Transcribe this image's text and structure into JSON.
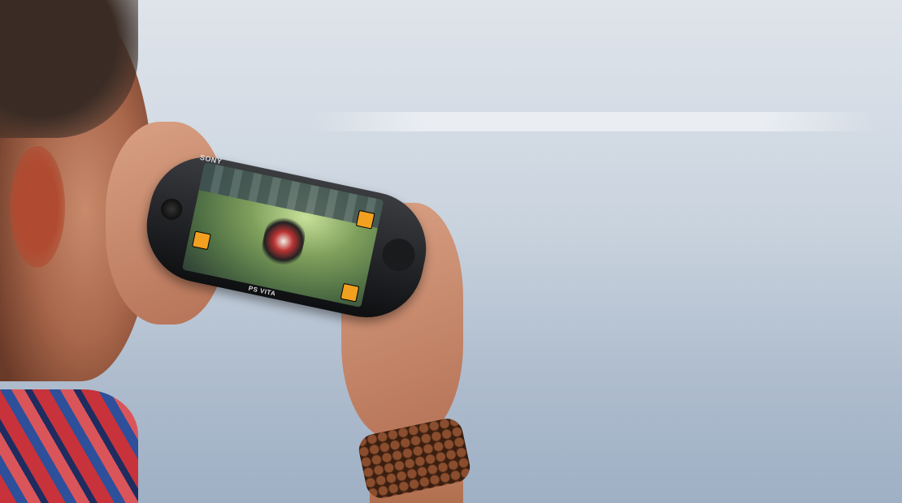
{
  "device": {
    "brand_logo": "SONY",
    "model_logo": "PS VITA"
  },
  "colors": {
    "background": "#c9d3de",
    "device_body": "#1a1b1d",
    "screen_green": "#7fa05c",
    "game_button": "#f2a020"
  }
}
